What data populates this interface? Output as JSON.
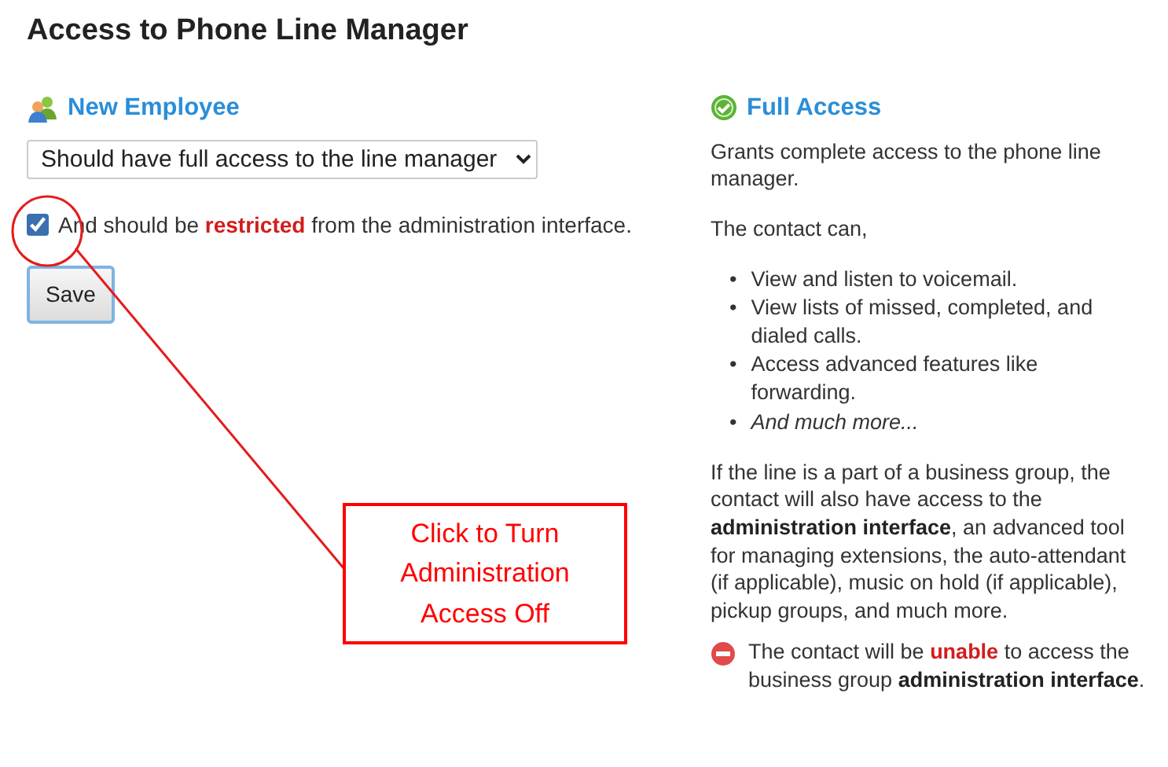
{
  "title": "Access to Phone Line Manager",
  "contact": {
    "name": "New Employee"
  },
  "access_select": {
    "value": "Should have full access to the line manager"
  },
  "restrict_option": {
    "checked": true,
    "parts": [
      {
        "text": "And should be ",
        "kind": "plain"
      },
      {
        "text": "restricted",
        "kind": "alert"
      },
      {
        "text": " from the administration interface.",
        "kind": "plain"
      }
    ]
  },
  "buttons": [
    "Save"
  ],
  "access_info": {
    "heading": "Full Access",
    "description": "Grants complete access to the phone line manager.",
    "intro": "The contact can,",
    "abilities": [
      {
        "marker": "•",
        "text": "View and listen to voicemail.",
        "italic": false
      },
      {
        "marker": "•",
        "text": "View lists of missed, completed, and dialed calls.",
        "italic": false
      },
      {
        "marker": "•",
        "text": "Access advanced features like forwarding.",
        "italic": false
      },
      {
        "marker": "•",
        "text": "And much more...",
        "italic": true
      }
    ],
    "business_note": [
      {
        "text": "If the line is a part of a business group, the contact will also have access to the ",
        "kind": "plain"
      },
      {
        "text": "administration interface",
        "kind": "bold"
      },
      {
        "text": ", an advanced tool for managing extensions, the auto-attendant (if applicable), music on hold (if applicable), pickup groups, and much more.",
        "kind": "plain"
      }
    ],
    "warning": [
      {
        "text": "The contact will be ",
        "kind": "plain"
      },
      {
        "text": "unable",
        "kind": "alert"
      },
      {
        "text": " to access the business group ",
        "kind": "plain"
      },
      {
        "text": "administration interface",
        "kind": "bold"
      },
      {
        "text": ".",
        "kind": "plain"
      }
    ]
  },
  "callout": {
    "text": "Click to Turn Administration Access Off"
  }
}
